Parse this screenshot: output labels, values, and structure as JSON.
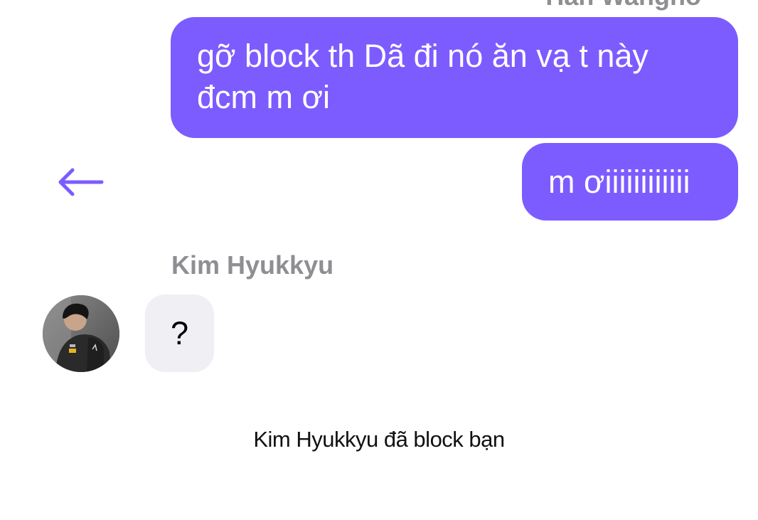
{
  "thread": {
    "top_sender_name": "Han Wangho",
    "outgoing_messages": [
      {
        "text": "gỡ block th Dã đi nó ăn vạ t này đcm m ơi"
      },
      {
        "text": "m ơiiiiiiiiiiii"
      }
    ],
    "incoming_sender_name": "Kim Hyukkyu",
    "incoming_messages": [
      {
        "text": "?"
      }
    ],
    "system_notice": "Kim Hyukkyu đã block bạn"
  },
  "icons": {
    "back": "arrow-left-icon"
  },
  "colors": {
    "outgoing_bubble": "#7c5cff",
    "incoming_bubble": "#efeff4",
    "accent": "#7c5cff",
    "name_gray": "#8e8e93",
    "background": "#ffffff"
  }
}
